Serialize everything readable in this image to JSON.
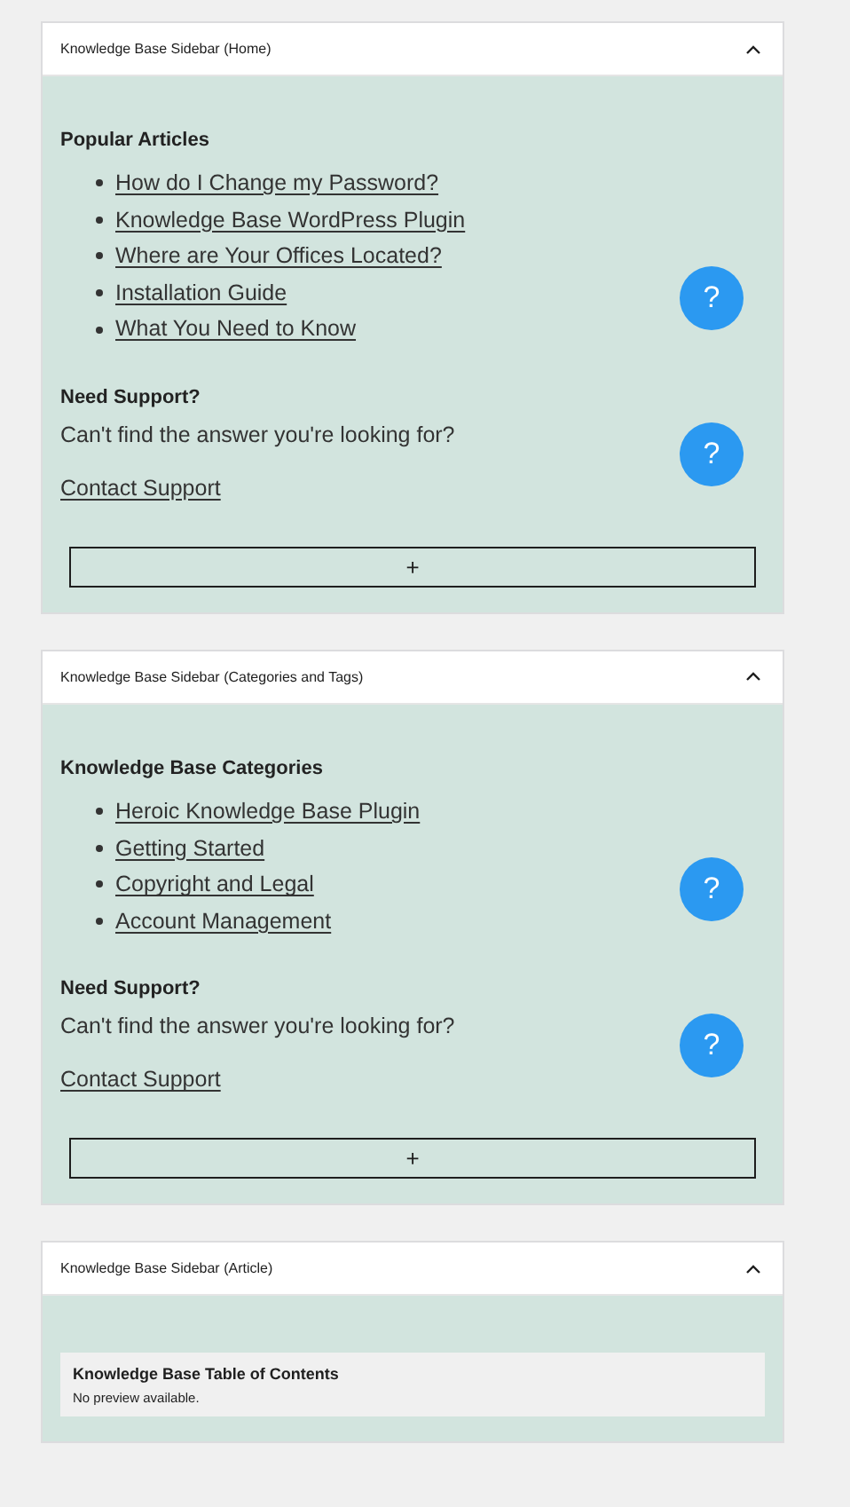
{
  "panels": [
    {
      "title": "Knowledge Base Sidebar (Home)",
      "expanded": true,
      "widgets": [
        {
          "kind": "list",
          "heading": "Popular Articles",
          "links": [
            "How do I Change my Password?",
            "Knowledge Base WordPress Plugin",
            "Where are Your Offices Located?",
            "Installation Guide",
            "What You Need to Know"
          ],
          "help": "?"
        },
        {
          "kind": "support",
          "heading": "Need Support?",
          "text": "Can't find the answer you're looking for?",
          "link": "Contact Support",
          "help": "?"
        }
      ],
      "add_button": "+"
    },
    {
      "title": "Knowledge Base Sidebar (Categories and Tags)",
      "expanded": true,
      "widgets": [
        {
          "kind": "list",
          "heading": "Knowledge Base Categories",
          "links": [
            "Heroic Knowledge Base Plugin",
            "Getting Started",
            "Copyright and Legal",
            "Account Management"
          ],
          "help": "?"
        },
        {
          "kind": "support",
          "heading": "Need Support?",
          "text": "Can't find the answer you're looking for?",
          "link": "Contact Support",
          "help": "?"
        }
      ],
      "add_button": "+"
    },
    {
      "title": "Knowledge Base Sidebar (Article)",
      "expanded": true,
      "widgets": [
        {
          "kind": "preview",
          "heading": "Knowledge Base Table of Contents",
          "text": "No preview available."
        }
      ]
    }
  ]
}
